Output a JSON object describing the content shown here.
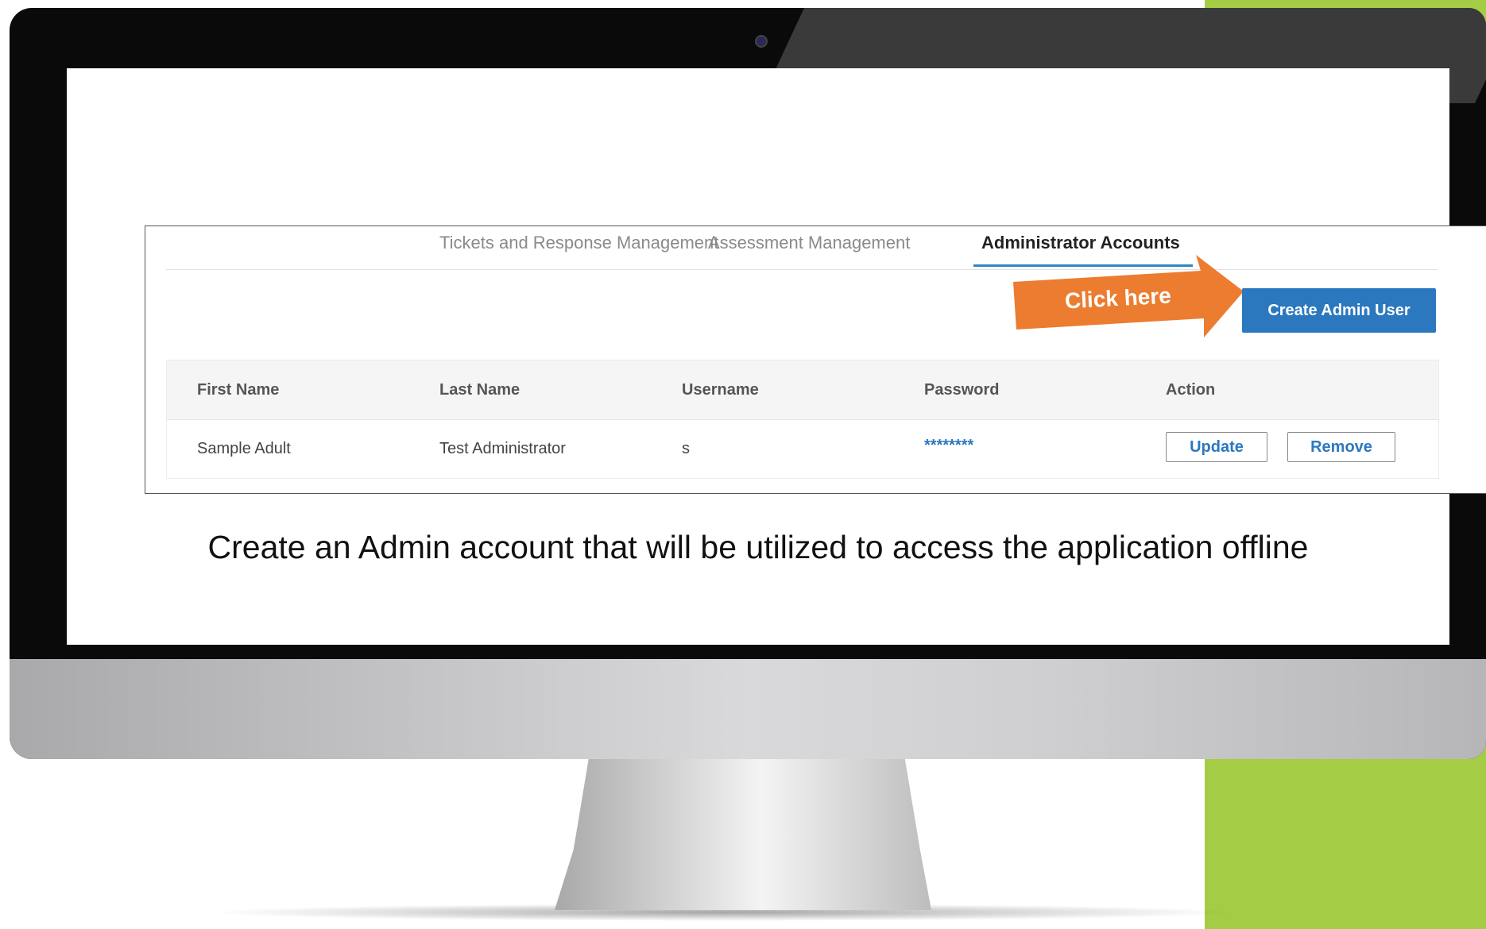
{
  "tabs": [
    {
      "label": "Tickets and Response Management",
      "active": false
    },
    {
      "label": "Assessment Management",
      "active": false
    },
    {
      "label": "Administrator Accounts",
      "active": true
    }
  ],
  "callout": {
    "label": "Click here",
    "color": "#ec7c30"
  },
  "create_button": {
    "label": "Create Admin User",
    "color": "#2b78bf"
  },
  "table": {
    "columns": [
      "First Name",
      "Last Name",
      "Username",
      "Password",
      "Action"
    ],
    "rows": [
      {
        "first_name": "Sample Adult",
        "last_name": "Test Administrator",
        "username": "s",
        "password": "********",
        "update_label": "Update",
        "remove_label": "Remove"
      }
    ]
  },
  "caption": "Create an Admin account that will be utilized to access the application offline",
  "colors": {
    "accent_green": "#a4cc45",
    "tab_underline": "#2f86c6"
  }
}
